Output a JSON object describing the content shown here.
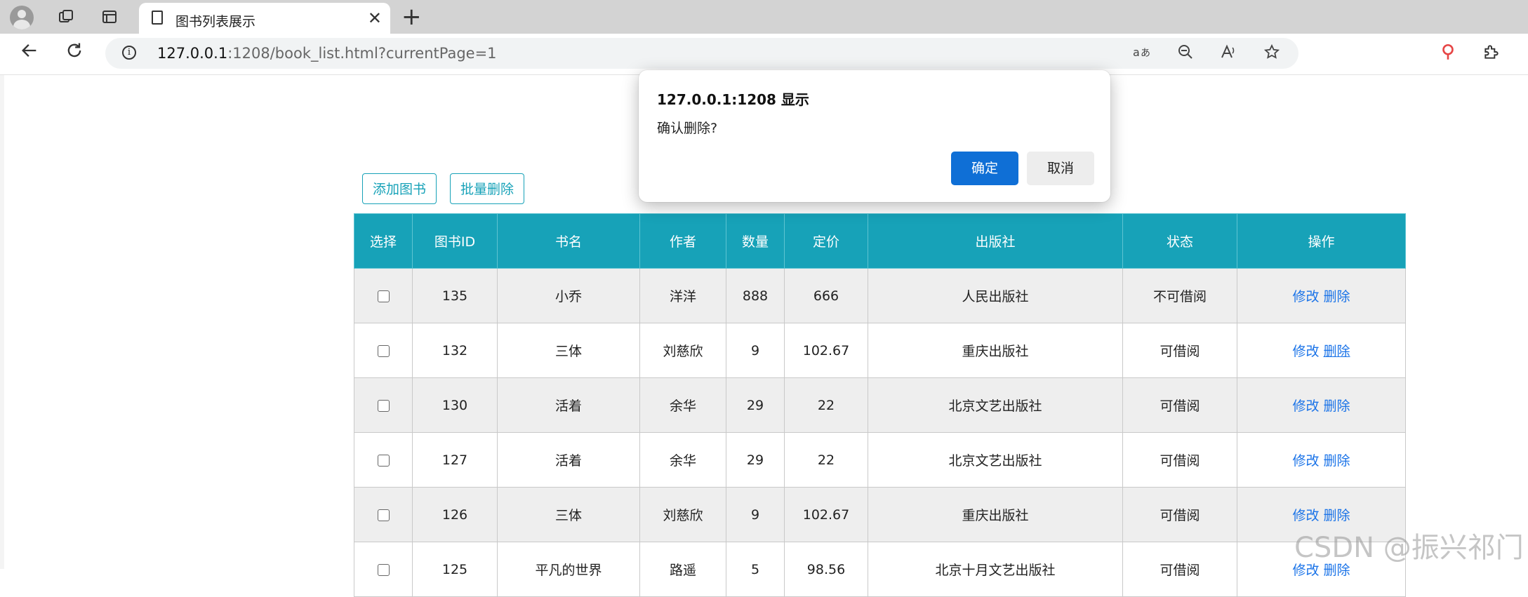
{
  "browser": {
    "tab_title": "图书列表展示",
    "close_glyph": "✕",
    "new_tab_glyph": "+",
    "url_host": "127.0.0.1",
    "url_rest": ":1208/book_list.html?currentPage=1"
  },
  "toolbar": {
    "add_label": "添加图书",
    "batch_delete_label": "批量删除"
  },
  "table": {
    "headers": [
      "选择",
      "图书ID",
      "书名",
      "作者",
      "数量",
      "定价",
      "出版社",
      "状态",
      "操作"
    ],
    "rows": [
      {
        "id": "135",
        "name": "小乔",
        "author": "洋洋",
        "count": "888",
        "price": "666",
        "publisher": "人民出版社",
        "status": "不可借阅"
      },
      {
        "id": "132",
        "name": "三体",
        "author": "刘慈欣",
        "count": "9",
        "price": "102.67",
        "publisher": "重庆出版社",
        "status": "可借阅"
      },
      {
        "id": "130",
        "name": "活着",
        "author": "余华",
        "count": "29",
        "price": "22",
        "publisher": "北京文艺出版社",
        "status": "可借阅"
      },
      {
        "id": "127",
        "name": "活着",
        "author": "余华",
        "count": "29",
        "price": "22",
        "publisher": "北京文艺出版社",
        "status": "可借阅"
      },
      {
        "id": "126",
        "name": "三体",
        "author": "刘慈欣",
        "count": "9",
        "price": "102.67",
        "publisher": "重庆出版社",
        "status": "可借阅"
      },
      {
        "id": "125",
        "name": "平凡的世界",
        "author": "路遥",
        "count": "5",
        "price": "98.56",
        "publisher": "北京十月文艺出版社",
        "status": "可借阅"
      }
    ],
    "edit_label": "修改",
    "delete_label": "删除"
  },
  "dialog": {
    "title": "127.0.0.1:1208 显示",
    "message": "确认删除?",
    "ok_label": "确定",
    "cancel_label": "取消"
  },
  "watermark": "CSDN @振兴祁门",
  "colors": {
    "table_header": "#17a2b8",
    "link": "#1a73e8",
    "ok_button": "#0f6fd6"
  }
}
